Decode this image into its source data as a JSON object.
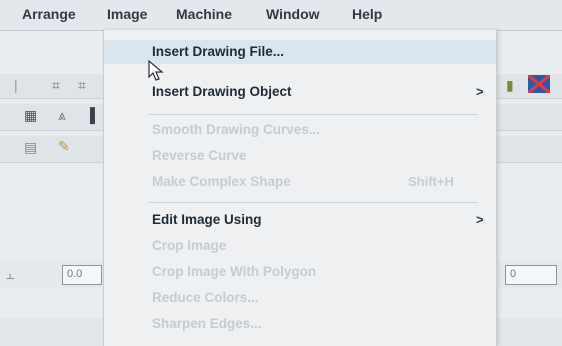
{
  "menubar": {
    "items": [
      {
        "label": "Arrange"
      },
      {
        "label": "Image"
      },
      {
        "label": "Machine"
      },
      {
        "label": "Window"
      },
      {
        "label": "Help"
      }
    ]
  },
  "image_menu": {
    "items": [
      {
        "label": "Insert Drawing File...",
        "enabled": true
      },
      {
        "label": "Insert Drawing Object",
        "enabled": true,
        "submenu_arrow": ">"
      },
      {
        "label": "Smooth Drawing Curves...",
        "enabled": false
      },
      {
        "label": "Reverse Curve",
        "enabled": false
      },
      {
        "label": "Make Complex Shape",
        "enabled": false,
        "shortcut": "Shift+H"
      },
      {
        "label": "Edit Image Using",
        "enabled": true,
        "submenu_arrow": ">"
      },
      {
        "label": "Crop Image",
        "enabled": false
      },
      {
        "label": "Crop Image With Polygon",
        "enabled": false
      },
      {
        "label": "Reduce Colors...",
        "enabled": false
      },
      {
        "label": "Sharpen Edges...",
        "enabled": false
      }
    ]
  },
  "toolbar": {
    "left_field_value": "0.0",
    "right_field_value": "0"
  },
  "icons": {
    "cursor": "mouse-pointer-icon",
    "grid_tool": "grid-icon",
    "triangle_tool": "triangle-icon",
    "flag_tool": "flag-icon"
  }
}
